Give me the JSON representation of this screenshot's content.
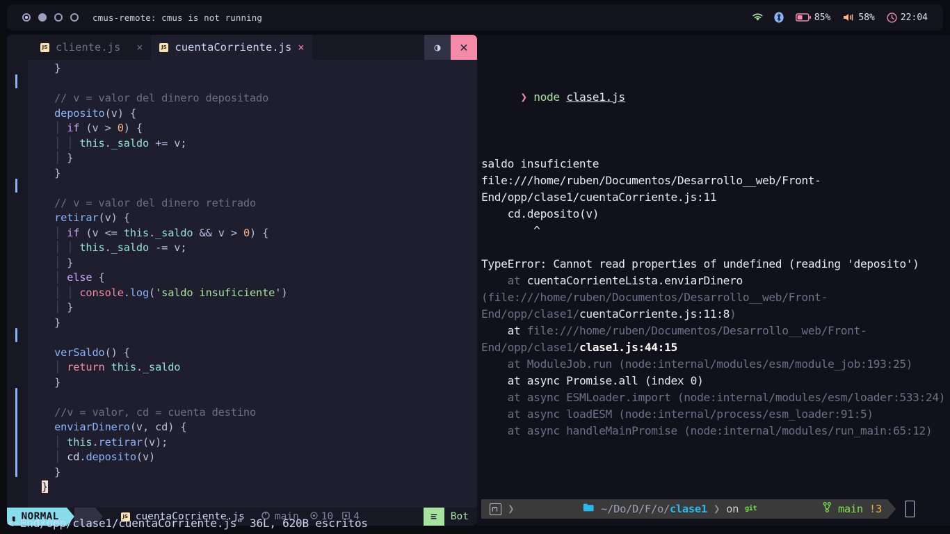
{
  "topbar": {
    "workspaces": [
      {
        "name": "workspace-1",
        "state": "active"
      },
      {
        "name": "workspace-2",
        "state": "filled"
      },
      {
        "name": "workspace-3",
        "state": "empty"
      },
      {
        "name": "workspace-4",
        "state": "empty"
      }
    ],
    "title": "cmus-remote: cmus is not running",
    "tray": {
      "wifi_icon": "wifi-icon",
      "bluetooth_icon": "bluetooth-icon",
      "battery_icon": "battery-icon",
      "battery_level": "85%",
      "volume_icon": "volume-icon",
      "volume_level": "58%",
      "clock_icon": "clock-icon",
      "clock": "22:04"
    },
    "colors": {
      "wifi": "#a6e3a1",
      "bluetooth": "#89b4fa",
      "battery": "#f38ba8",
      "volume": "#fab387",
      "clock": "#f38ba8"
    }
  },
  "editor": {
    "tabs": [
      {
        "label": "cliente.js",
        "active": false,
        "close": "×"
      },
      {
        "label": "cuentaCorriente.js",
        "active": true,
        "close": "×"
      }
    ],
    "window_buttons": {
      "toggle": "◑",
      "close": "✕"
    },
    "lines": [
      {
        "indent": 0,
        "segments": [
          {
            "t": "  }",
            "c": "c-punc"
          }
        ]
      },
      {
        "indent": 0,
        "segments": []
      },
      {
        "indent": 0,
        "segments": [
          {
            "t": "  // v = valor del dinero depositado",
            "c": "c-com"
          }
        ]
      },
      {
        "indent": 0,
        "segments": [
          {
            "t": "  ",
            "c": "c-var"
          },
          {
            "t": "deposito",
            "c": "c-fn"
          },
          {
            "t": "(v) {",
            "c": "c-punc"
          }
        ]
      },
      {
        "indent": 0,
        "segments": [
          {
            "t": "  ",
            "c": "c-var"
          },
          {
            "t": "│ ",
            "c": "iguide"
          },
          {
            "t": "if",
            "c": "c-kw"
          },
          {
            "t": " (v > ",
            "c": "c-punc"
          },
          {
            "t": "0",
            "c": "c-num"
          },
          {
            "t": ") {",
            "c": "c-punc"
          }
        ]
      },
      {
        "indent": 0,
        "segments": [
          {
            "t": "  ",
            "c": "c-var"
          },
          {
            "t": "│ │ ",
            "c": "iguide"
          },
          {
            "t": "this",
            "c": "c-this"
          },
          {
            "t": ".",
            "c": "c-punc"
          },
          {
            "t": "_saldo",
            "c": "c-this"
          },
          {
            "t": " += v;",
            "c": "c-punc"
          }
        ]
      },
      {
        "indent": 0,
        "segments": [
          {
            "t": "  ",
            "c": "c-var"
          },
          {
            "t": "│ ",
            "c": "iguide"
          },
          {
            "t": "}",
            "c": "c-punc"
          }
        ]
      },
      {
        "indent": 0,
        "segments": [
          {
            "t": "  }",
            "c": "c-punc"
          }
        ]
      },
      {
        "indent": 0,
        "segments": []
      },
      {
        "indent": 0,
        "segments": [
          {
            "t": "  // v = valor del dinero retirado",
            "c": "c-com"
          }
        ]
      },
      {
        "indent": 0,
        "segments": [
          {
            "t": "  ",
            "c": "c-var"
          },
          {
            "t": "retirar",
            "c": "c-fn"
          },
          {
            "t": "(v) {",
            "c": "c-punc"
          }
        ]
      },
      {
        "indent": 0,
        "segments": [
          {
            "t": "  ",
            "c": "c-var"
          },
          {
            "t": "│ ",
            "c": "iguide"
          },
          {
            "t": "if",
            "c": "c-kw"
          },
          {
            "t": " (v <= ",
            "c": "c-punc"
          },
          {
            "t": "this",
            "c": "c-this"
          },
          {
            "t": ".",
            "c": "c-punc"
          },
          {
            "t": "_saldo",
            "c": "c-this"
          },
          {
            "t": " && v > ",
            "c": "c-punc"
          },
          {
            "t": "0",
            "c": "c-num"
          },
          {
            "t": ") {",
            "c": "c-punc"
          }
        ]
      },
      {
        "indent": 0,
        "segments": [
          {
            "t": "  ",
            "c": "c-var"
          },
          {
            "t": "│ │ ",
            "c": "iguide"
          },
          {
            "t": "this",
            "c": "c-this"
          },
          {
            "t": ".",
            "c": "c-punc"
          },
          {
            "t": "_saldo",
            "c": "c-this"
          },
          {
            "t": " -= v;",
            "c": "c-punc"
          }
        ]
      },
      {
        "indent": 0,
        "segments": [
          {
            "t": "  ",
            "c": "c-var"
          },
          {
            "t": "│ ",
            "c": "iguide"
          },
          {
            "t": "}",
            "c": "c-punc"
          }
        ]
      },
      {
        "indent": 0,
        "segments": [
          {
            "t": "  ",
            "c": "c-var"
          },
          {
            "t": "│ ",
            "c": "iguide"
          },
          {
            "t": "else",
            "c": "c-kw"
          },
          {
            "t": " {",
            "c": "c-punc"
          }
        ]
      },
      {
        "indent": 0,
        "segments": [
          {
            "t": "  ",
            "c": "c-var"
          },
          {
            "t": "│ │ ",
            "c": "iguide"
          },
          {
            "t": "console",
            "c": "c-obj"
          },
          {
            "t": ".",
            "c": "c-punc"
          },
          {
            "t": "log",
            "c": "c-prop"
          },
          {
            "t": "(",
            "c": "c-punc"
          },
          {
            "t": "'saldo insuficiente'",
            "c": "c-str"
          },
          {
            "t": ")",
            "c": "c-punc"
          }
        ]
      },
      {
        "indent": 0,
        "segments": [
          {
            "t": "  ",
            "c": "c-var"
          },
          {
            "t": "│ ",
            "c": "iguide"
          },
          {
            "t": "}",
            "c": "c-punc"
          }
        ]
      },
      {
        "indent": 0,
        "segments": [
          {
            "t": "  }",
            "c": "c-punc"
          }
        ]
      },
      {
        "indent": 0,
        "segments": []
      },
      {
        "indent": 0,
        "segments": [
          {
            "t": "  ",
            "c": "c-var"
          },
          {
            "t": "verSaldo",
            "c": "c-fn"
          },
          {
            "t": "() {",
            "c": "c-punc"
          }
        ]
      },
      {
        "indent": 0,
        "segments": [
          {
            "t": "  ",
            "c": "c-var"
          },
          {
            "t": "│ ",
            "c": "iguide"
          },
          {
            "t": "return",
            "c": "c-kw2"
          },
          {
            "t": " ",
            "c": "c-punc"
          },
          {
            "t": "this",
            "c": "c-this"
          },
          {
            "t": ".",
            "c": "c-punc"
          },
          {
            "t": "_saldo",
            "c": "c-this"
          }
        ]
      },
      {
        "indent": 0,
        "segments": [
          {
            "t": "  }",
            "c": "c-punc"
          }
        ]
      },
      {
        "indent": 0,
        "segments": []
      },
      {
        "indent": 0,
        "segments": [
          {
            "t": "  //v = valor, cd = cuenta destino",
            "c": "c-com"
          }
        ]
      },
      {
        "indent": 0,
        "segments": [
          {
            "t": "  ",
            "c": "c-var"
          },
          {
            "t": "enviarDinero",
            "c": "c-fn"
          },
          {
            "t": "(v, cd) {",
            "c": "c-punc"
          }
        ]
      },
      {
        "indent": 0,
        "segments": [
          {
            "t": "  ",
            "c": "c-var"
          },
          {
            "t": "│ ",
            "c": "iguide"
          },
          {
            "t": "this",
            "c": "c-this"
          },
          {
            "t": ".",
            "c": "c-punc"
          },
          {
            "t": "retirar",
            "c": "c-prop"
          },
          {
            "t": "(v);",
            "c": "c-punc"
          }
        ]
      },
      {
        "indent": 0,
        "segments": [
          {
            "t": "  ",
            "c": "c-var"
          },
          {
            "t": "│ ",
            "c": "iguide"
          },
          {
            "t": "cd",
            "c": "c-var"
          },
          {
            "t": ".",
            "c": "c-punc"
          },
          {
            "t": "deposito",
            "c": "c-prop"
          },
          {
            "t": "(v)",
            "c": "c-punc"
          }
        ]
      },
      {
        "indent": 0,
        "segments": [
          {
            "t": "  }",
            "c": "c-punc"
          }
        ]
      },
      {
        "indent": 0,
        "cursor": true,
        "segments": [
          {
            "t": "}",
            "c": "cursorblk"
          }
        ]
      }
    ],
    "statusline": {
      "mode": "NORMAL",
      "mode_icon": "vim-icon",
      "file_icon": "js-file-icon",
      "filename": "cuentaCorriente.js",
      "git_icon": "git-branch-icon",
      "branch": "main",
      "diag1_icon": "error-circle-icon",
      "diag1_count": "10",
      "diag2_icon": "warning-square-icon",
      "diag2_count": "4",
      "page_icon": "lines-icon",
      "position": "Bot"
    },
    "cmdline": "<-End/opp/clase1/cuentaCorriente.js\" 36L, 620B escritos"
  },
  "terminal": {
    "prompt_symbol": "❯",
    "command": "node",
    "command_arg": "clase1.js",
    "output": [
      {
        "segments": [
          {
            "t": "saldo insuficiente",
            "c": "t-bright"
          }
        ]
      },
      {
        "segments": [
          {
            "t": "file:///home/ruben/Documentos/Desarrollo__web/Front-End/opp/clase1/cuentaCorriente.js:11",
            "c": "t-bright"
          }
        ]
      },
      {
        "segments": [
          {
            "t": "    cd.deposito(v)",
            "c": "t-bright"
          }
        ]
      },
      {
        "segments": [
          {
            "t": "        ^",
            "c": "t-bright"
          }
        ]
      },
      {
        "segments": [
          {
            "t": "",
            "c": "t-bright"
          }
        ]
      },
      {
        "segments": [
          {
            "t": "TypeError: Cannot read properties of undefined (reading 'deposito')",
            "c": "t-bright"
          }
        ]
      },
      {
        "segments": [
          {
            "t": "    at ",
            "c": "t-dim"
          },
          {
            "t": "cuentaCorrienteLista.enviarDinero",
            "c": "t-bright"
          },
          {
            "t": " (file:///home/ruben/Documentos/Desarrollo__web/Front-End/opp/clase1/",
            "c": "t-dim"
          },
          {
            "t": "cuentaCorriente.js:11:8",
            "c": "t-bright"
          },
          {
            "t": ")",
            "c": "t-dim"
          }
        ]
      },
      {
        "segments": [
          {
            "t": "    at ",
            "c": "t-bright"
          },
          {
            "t": "file:///home/ruben/Documentos/Desarrollo__web/Front-End/opp/clase1/",
            "c": "t-dim"
          },
          {
            "t": "clase1.js:44:15",
            "c": "t-white"
          }
        ]
      },
      {
        "segments": [
          {
            "t": "    at ModuleJob.run (node:internal/modules/esm/module_job:193:25)",
            "c": "t-dim"
          }
        ]
      },
      {
        "segments": [
          {
            "t": "    at async Promise.all (index 0)",
            "c": "t-bright"
          }
        ]
      },
      {
        "segments": [
          {
            "t": "    at async ESMLoader.import (node:internal/modules/esm/loader:533:24)",
            "c": "t-dim"
          }
        ]
      },
      {
        "segments": [
          {
            "t": "    at async loadESM (node:internal/process/esm_loader:91:5)",
            "c": "t-dim"
          }
        ]
      },
      {
        "segments": [
          {
            "t": "    at async handleMainPromise (node:internal/modules/run_main:65:12)",
            "c": "t-dim"
          }
        ]
      }
    ],
    "prompt": {
      "os_icon": "linux-mint-icon",
      "chevron": "❯",
      "folder_icon": "folder-icon",
      "path_prefix": "~/Do/D/F/o/",
      "path_current": "clase1",
      "on_label": "on",
      "git_label": "git",
      "git_icon": "git-branch-icon",
      "branch": "main",
      "status": "!3"
    }
  }
}
